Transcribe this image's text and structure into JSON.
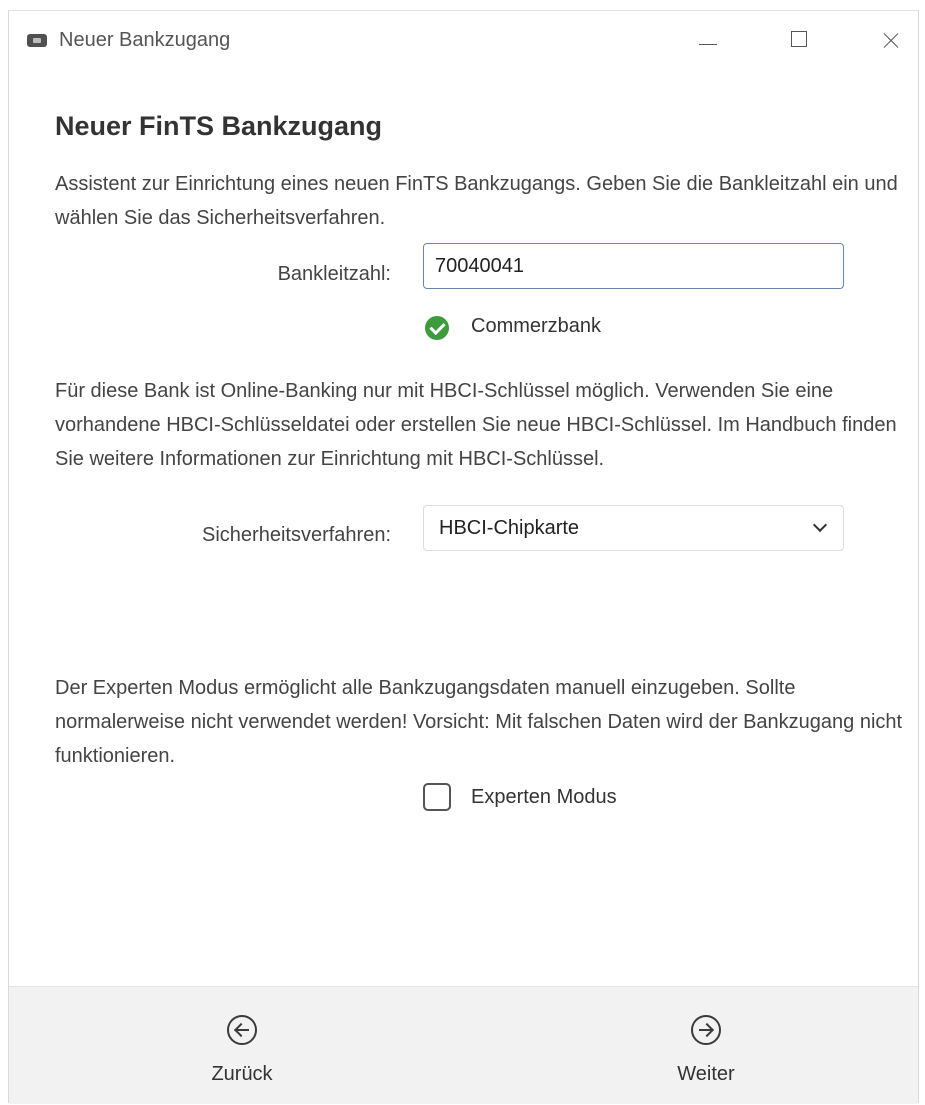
{
  "window": {
    "title": "Neuer Bankzugang"
  },
  "page": {
    "heading": "Neuer FinTS Bankzugang",
    "intro": "Assistent zur Einrichtung eines neuen FinTS Bankzugangs. Geben Sie die Bankleitzahl ein und wählen Sie das Sicherheitsverfahren."
  },
  "bank_code": {
    "label": "Bankleitzahl:",
    "value": "70040041",
    "bank_name": "Commerzbank",
    "status_icon": "check-circle-icon",
    "status_color": "#3d9b3d"
  },
  "hbci_info": "Für diese Bank ist Online-Banking nur mit HBCI-Schlüssel möglich. Verwenden Sie eine vorhandene HBCI-Schlüsseldatei oder erstellen Sie neue HBCI-Schlüssel. Im Handbuch finden Sie weitere Informationen zur Einrichtung mit HBCI-Schlüssel.",
  "security": {
    "label": "Sicherheitsverfahren:",
    "selected": "HBCI-Chipkarte"
  },
  "expert": {
    "info": "Der Experten Modus ermöglicht alle Bankzugangsdaten manuell einzugeben. Sollte normalerweise nicht verwendet werden! Vorsicht: Mit falschen Daten wird der Bankzugang nicht funktionieren.",
    "checkbox_label": "Experten Modus",
    "checked": false
  },
  "footer": {
    "back_label": "Zurück",
    "next_label": "Weiter"
  }
}
